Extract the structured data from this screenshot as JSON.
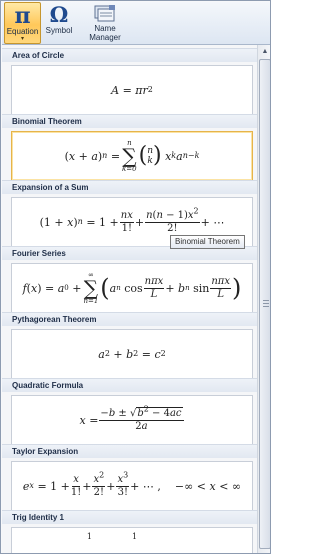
{
  "ribbon": {
    "equation_label": "Equation",
    "equation_glyph": "π",
    "symbol_label": "Symbol",
    "symbol_glyph": "Ω",
    "name_manager_label_1": "Name",
    "name_manager_label_2": "Manager"
  },
  "gallery": {
    "sections": [
      {
        "title": "Area of Circle"
      },
      {
        "title": "Binomial Theorem"
      },
      {
        "title": "Expansion of a Sum"
      },
      {
        "title": "Fourier Series"
      },
      {
        "title": "Pythagorean Theorem"
      },
      {
        "title": "Quadratic Formula"
      },
      {
        "title": "Taylor Expansion"
      },
      {
        "title": "Trig Identity 1"
      }
    ]
  },
  "tooltip": {
    "text": "Binomial Theorem"
  },
  "colors": {
    "selected_button": "#ffc85a",
    "selected_border": "#e6b44a",
    "header_text": "#1e2d47"
  }
}
